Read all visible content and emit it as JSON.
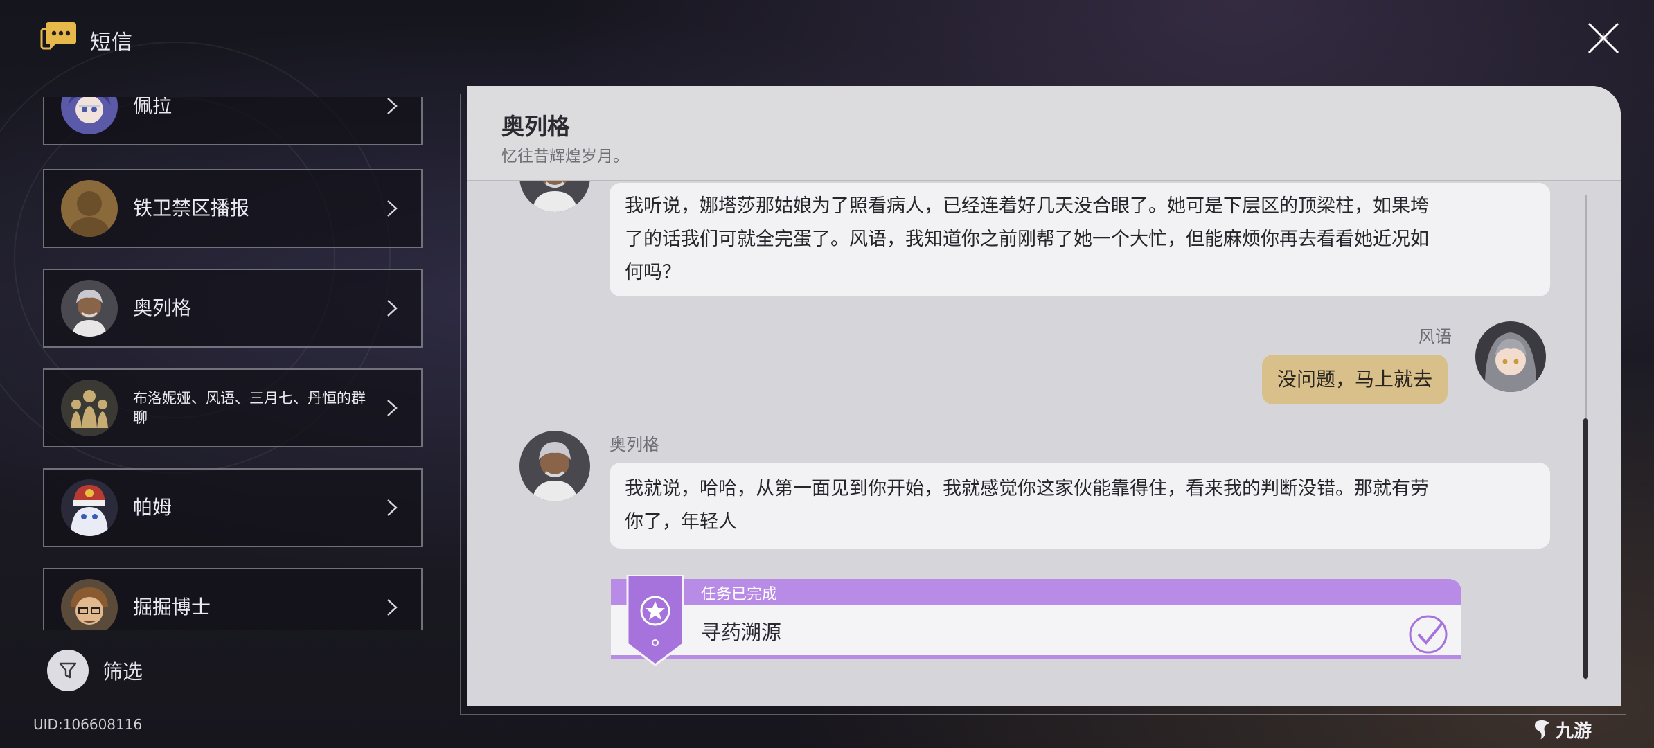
{
  "app": {
    "title": "短信"
  },
  "contacts": [
    {
      "name": "佩拉",
      "avatar": "pela-avatar"
    },
    {
      "name": "铁卫禁区播报",
      "avatar": "silhouette-avatar"
    },
    {
      "name": "奥列格",
      "avatar": "oleg-avatar"
    },
    {
      "name": "布洛妮娅、风语、三月七、丹恒的群聊",
      "avatar": "group-avatar"
    },
    {
      "name": "帕姆",
      "avatar": "pom-pom-avatar"
    },
    {
      "name": "掘掘博士",
      "avatar": "dr-dig-avatar"
    }
  ],
  "filter": {
    "label": "筛选"
  },
  "uid": "UID:106608116",
  "chat": {
    "contact_name": "奥列格",
    "contact_signature": "忆往昔辉煌岁月。",
    "messages": [
      {
        "from": "other",
        "text_lines": [
          "我听说，娜塔莎那姑娘为了照看病人，已经连着好几天没合眼了。她可是下层区的顶梁柱，如果垮",
          "了的话我们可就全完蛋了。风语，我知道你之前刚帮了她一个大忙，但能麻烦你再去看看她近况如",
          "何吗？"
        ]
      },
      {
        "from": "me",
        "sender": "风语",
        "text": "没问题，马上就去"
      },
      {
        "from": "other",
        "sender": "奥列格",
        "text_lines": [
          "我就说，哈哈，从第一面见到你开始，我就感觉你这家伙能靠得住，看来我的判断没错。那就有劳",
          "你了，年轻人"
        ]
      }
    ],
    "mission": {
      "status": "任务已完成",
      "title": "寻药溯源",
      "accent": "#b88be6"
    }
  },
  "watermark": "九游",
  "colors": {
    "panel_bg": "#d6d6da",
    "bubble_other": "#f2f2f4",
    "bubble_me": "#d9bf8a",
    "mission_purple": "#b88be6"
  }
}
